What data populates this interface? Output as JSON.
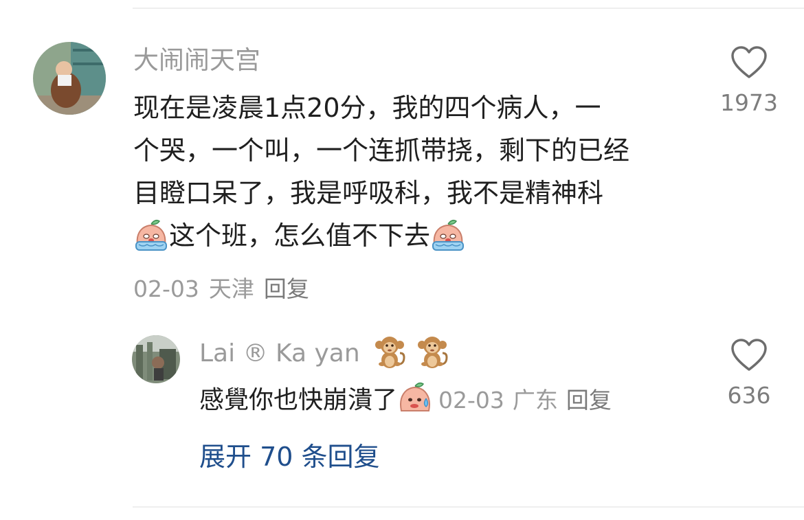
{
  "comment": {
    "username": "大闹闹天宫",
    "lines": [
      "现在是凌晨1点20分，我的四个病人，一",
      "个哭，一个叫，一个连抓带挠，剩下的已经",
      "目瞪口呆了，我是呼吸科，我不是精神科",
      "这个班，怎么值不下去"
    ],
    "date": "02-03",
    "location": "天津",
    "reply_label": "回复",
    "likes": "1973",
    "emoji": "crying-face-sticker"
  },
  "reply": {
    "username": "Lai ® Ka yan",
    "username_emojis": [
      "monkey-emoji",
      "monkey-emoji"
    ],
    "text": "感覺你也快崩潰了",
    "emoji": "sweating-face-sticker",
    "date": "02-03",
    "location": "广东",
    "reply_label": "回复",
    "likes": "636"
  },
  "expand_replies": "展开 70 条回复",
  "colors": {
    "link": "#1f4e8c",
    "meta": "#9a9a9a",
    "text": "#1f1f1f"
  }
}
